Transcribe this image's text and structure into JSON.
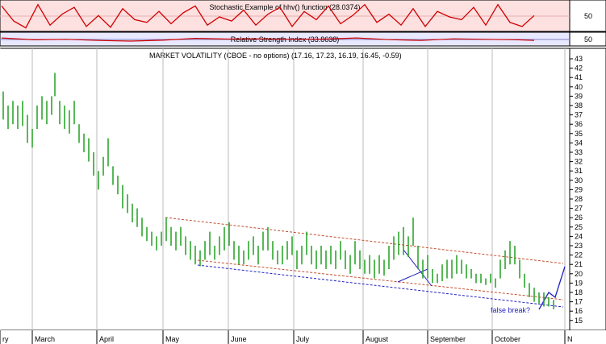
{
  "chart_data": [
    {
      "type": "line",
      "title": "Stochastic Example of hhv() function (28.0374)",
      "yticks": [
        50
      ],
      "series": [
        {
          "x": [
            0,
            15,
            30,
            45,
            60,
            75,
            90,
            105,
            120,
            135,
            150,
            165,
            180,
            195,
            210,
            225,
            240,
            255,
            270,
            285,
            300,
            315,
            330,
            345,
            360,
            375,
            390,
            405,
            420,
            435,
            450,
            465,
            480,
            495,
            510,
            525,
            540,
            555,
            570,
            585,
            600,
            615,
            630,
            645,
            660
          ],
          "values": [
            90,
            35,
            10,
            95,
            20,
            60,
            85,
            15,
            55,
            12,
            80,
            40,
            30,
            70,
            25,
            65,
            90,
            20,
            50,
            35,
            75,
            20,
            60,
            85,
            15,
            70,
            40,
            90,
            25,
            55,
            95,
            30,
            60,
            20,
            80,
            15,
            70,
            50,
            40,
            85,
            20,
            95,
            30,
            15,
            55
          ]
        }
      ]
    },
    {
      "type": "line",
      "title": "Relative Strength Index (33.8638)",
      "yticks": [
        50
      ],
      "series": [
        {
          "x": [
            0,
            40,
            80,
            120,
            160,
            200,
            240,
            280,
            320,
            360,
            400,
            440,
            480,
            520,
            560,
            600,
            640,
            660
          ],
          "values": [
            58,
            45,
            48,
            40,
            35,
            42,
            55,
            50,
            52,
            48,
            50,
            58,
            46,
            40,
            52,
            48,
            45,
            40
          ]
        }
      ]
    },
    {
      "type": "bar",
      "title": "MARKET VOLATILITY (CBOE - no options) (17.16, 17.23, 16.19, 16.45, -0.59)",
      "ylim": [
        14.5,
        43.5
      ],
      "yticks": [
        15,
        16,
        17,
        18,
        19,
        20,
        21,
        22,
        23,
        24,
        25,
        26,
        27,
        28,
        29,
        30,
        31,
        32,
        33,
        34,
        35,
        36,
        37,
        38,
        39,
        40,
        41,
        42,
        43
      ],
      "month_labels": [
        "ry",
        "March",
        "April",
        "May",
        "June",
        "July",
        "August",
        "September",
        "October",
        "N"
      ],
      "ohlc": [
        {
          "x": 4,
          "high": 39.5,
          "low": 36.5
        },
        {
          "x": 10,
          "high": 38.0,
          "low": 35.5
        },
        {
          "x": 16,
          "high": 38.5,
          "low": 36.0
        },
        {
          "x": 22,
          "high": 38.0,
          "low": 35.5
        },
        {
          "x": 28,
          "high": 38.5,
          "low": 35.8
        },
        {
          "x": 34,
          "high": 37.0,
          "low": 34.0
        },
        {
          "x": 40,
          "high": 35.5,
          "low": 33.5
        },
        {
          "x": 46,
          "high": 38.0,
          "low": 35.5
        },
        {
          "x": 52,
          "high": 39.0,
          "low": 36.5
        },
        {
          "x": 58,
          "high": 38.5,
          "low": 36.0
        },
        {
          "x": 64,
          "high": 39.0,
          "low": 37.0
        },
        {
          "x": 68,
          "high": 41.5,
          "low": 39.0
        },
        {
          "x": 74,
          "high": 38.5,
          "low": 36.0
        },
        {
          "x": 80,
          "high": 38.0,
          "low": 35.5
        },
        {
          "x": 86,
          "high": 37.5,
          "low": 35.0
        },
        {
          "x": 92,
          "high": 38.5,
          "low": 36.0
        },
        {
          "x": 98,
          "high": 36.0,
          "low": 34.0
        },
        {
          "x": 104,
          "high": 35.0,
          "low": 33.0
        },
        {
          "x": 110,
          "high": 34.5,
          "low": 32.0
        },
        {
          "x": 116,
          "high": 33.0,
          "low": 30.5
        },
        {
          "x": 122,
          "high": 31.0,
          "low": 29.0
        },
        {
          "x": 128,
          "high": 32.5,
          "low": 30.5
        },
        {
          "x": 134,
          "high": 34.5,
          "low": 31.5
        },
        {
          "x": 140,
          "high": 31.5,
          "low": 29.5
        },
        {
          "x": 146,
          "high": 30.5,
          "low": 28.5
        },
        {
          "x": 152,
          "high": 29.5,
          "low": 27.0
        },
        {
          "x": 158,
          "high": 28.5,
          "low": 26.5
        },
        {
          "x": 164,
          "high": 27.5,
          "low": 25.5
        },
        {
          "x": 170,
          "high": 27.0,
          "low": 25.0
        },
        {
          "x": 176,
          "high": 26.0,
          "low": 24.0
        },
        {
          "x": 182,
          "high": 25.0,
          "low": 23.5
        },
        {
          "x": 188,
          "high": 24.5,
          "low": 23.0
        },
        {
          "x": 194,
          "high": 24.0,
          "low": 22.5
        },
        {
          "x": 200,
          "high": 24.5,
          "low": 23.0
        },
        {
          "x": 206,
          "high": 26.0,
          "low": 23.5
        },
        {
          "x": 212,
          "high": 25.0,
          "low": 23.0
        },
        {
          "x": 218,
          "high": 24.5,
          "low": 22.5
        },
        {
          "x": 224,
          "high": 25.0,
          "low": 23.0
        },
        {
          "x": 230,
          "high": 24.0,
          "low": 22.0
        },
        {
          "x": 236,
          "high": 23.5,
          "low": 21.5
        },
        {
          "x": 242,
          "high": 23.0,
          "low": 21.0
        },
        {
          "x": 248,
          "high": 22.5,
          "low": 20.8
        },
        {
          "x": 254,
          "high": 23.5,
          "low": 21.5
        },
        {
          "x": 260,
          "high": 24.5,
          "low": 22.0
        },
        {
          "x": 266,
          "high": 23.0,
          "low": 21.5
        },
        {
          "x": 272,
          "high": 24.0,
          "low": 22.0
        },
        {
          "x": 278,
          "high": 25.0,
          "low": 22.5
        },
        {
          "x": 284,
          "high": 25.5,
          "low": 23.0
        },
        {
          "x": 290,
          "high": 23.5,
          "low": 21.5
        },
        {
          "x": 296,
          "high": 23.0,
          "low": 21.0
        },
        {
          "x": 302,
          "high": 22.5,
          "low": 21.0
        },
        {
          "x": 308,
          "high": 23.5,
          "low": 21.5
        },
        {
          "x": 314,
          "high": 24.0,
          "low": 22.0
        },
        {
          "x": 320,
          "high": 23.0,
          "low": 21.0
        },
        {
          "x": 326,
          "high": 24.5,
          "low": 22.5
        },
        {
          "x": 332,
          "high": 25.0,
          "low": 22.5
        },
        {
          "x": 338,
          "high": 23.5,
          "low": 21.5
        },
        {
          "x": 344,
          "high": 22.5,
          "low": 21.0
        },
        {
          "x": 350,
          "high": 23.0,
          "low": 21.0
        },
        {
          "x": 356,
          "high": 23.5,
          "low": 21.5
        },
        {
          "x": 362,
          "high": 24.0,
          "low": 22.0
        },
        {
          "x": 368,
          "high": 22.5,
          "low": 20.5
        },
        {
          "x": 374,
          "high": 23.0,
          "low": 21.0
        },
        {
          "x": 380,
          "high": 24.5,
          "low": 22.0
        },
        {
          "x": 386,
          "high": 23.0,
          "low": 21.0
        },
        {
          "x": 392,
          "high": 22.5,
          "low": 20.5
        },
        {
          "x": 398,
          "high": 23.0,
          "low": 21.0
        },
        {
          "x": 404,
          "high": 22.5,
          "low": 20.5
        },
        {
          "x": 410,
          "high": 23.0,
          "low": 21.0
        },
        {
          "x": 416,
          "high": 22.5,
          "low": 20.5
        },
        {
          "x": 422,
          "high": 23.5,
          "low": 21.5
        },
        {
          "x": 428,
          "high": 22.5,
          "low": 20.5
        },
        {
          "x": 434,
          "high": 22.0,
          "low": 20.0
        },
        {
          "x": 440,
          "high": 23.5,
          "low": 21.0
        },
        {
          "x": 446,
          "high": 22.5,
          "low": 20.5
        },
        {
          "x": 452,
          "high": 21.5,
          "low": 20.0
        },
        {
          "x": 458,
          "high": 22.0,
          "low": 20.0
        },
        {
          "x": 464,
          "high": 21.5,
          "low": 19.5
        },
        {
          "x": 470,
          "high": 22.0,
          "low": 20.0
        },
        {
          "x": 476,
          "high": 21.5,
          "low": 19.8
        },
        {
          "x": 482,
          "high": 23.0,
          "low": 20.5
        },
        {
          "x": 488,
          "high": 24.0,
          "low": 21.5
        },
        {
          "x": 494,
          "high": 24.5,
          "low": 22.0
        },
        {
          "x": 500,
          "high": 25.0,
          "low": 22.0
        },
        {
          "x": 506,
          "high": 24.0,
          "low": 21.8
        },
        {
          "x": 512,
          "high": 26.0,
          "low": 23.0
        },
        {
          "x": 518,
          "high": 23.0,
          "low": 20.5
        },
        {
          "x": 524,
          "high": 21.5,
          "low": 19.5
        },
        {
          "x": 530,
          "high": 22.0,
          "low": 19.5
        },
        {
          "x": 536,
          "high": 20.5,
          "low": 19.0
        },
        {
          "x": 542,
          "high": 20.0,
          "low": 19.0
        },
        {
          "x": 548,
          "high": 21.0,
          "low": 19.2
        },
        {
          "x": 554,
          "high": 21.5,
          "low": 19.5
        },
        {
          "x": 560,
          "high": 21.5,
          "low": 19.5
        },
        {
          "x": 566,
          "high": 22.0,
          "low": 20.0
        },
        {
          "x": 572,
          "high": 21.5,
          "low": 20.0
        },
        {
          "x": 578,
          "high": 21.0,
          "low": 19.5
        },
        {
          "x": 584,
          "high": 20.5,
          "low": 19.5
        },
        {
          "x": 590,
          "high": 20.0,
          "low": 19.0
        },
        {
          "x": 596,
          "high": 20.0,
          "low": 19.0
        },
        {
          "x": 602,
          "high": 19.5,
          "low": 18.8
        },
        {
          "x": 608,
          "high": 20.0,
          "low": 19.0
        },
        {
          "x": 614,
          "high": 19.5,
          "low": 18.5
        },
        {
          "x": 620,
          "high": 21.5,
          "low": 19.5
        },
        {
          "x": 626,
          "high": 22.5,
          "low": 20.5
        },
        {
          "x": 632,
          "high": 23.5,
          "low": 21.0
        },
        {
          "x": 638,
          "high": 23.0,
          "low": 21.0
        },
        {
          "x": 644,
          "high": 21.5,
          "low": 19.5
        },
        {
          "x": 650,
          "high": 20.0,
          "low": 18.5
        },
        {
          "x": 656,
          "high": 19.0,
          "low": 17.5
        },
        {
          "x": 662,
          "high": 18.5,
          "low": 17.0
        },
        {
          "x": 668,
          "high": 18.0,
          "low": 16.8
        },
        {
          "x": 674,
          "high": 18.0,
          "low": 16.5
        },
        {
          "x": 680,
          "high": 17.5,
          "low": 16.5
        },
        {
          "x": 686,
          "high": 17.2,
          "low": 16.2
        }
      ],
      "annotation": "false break?"
    }
  ]
}
